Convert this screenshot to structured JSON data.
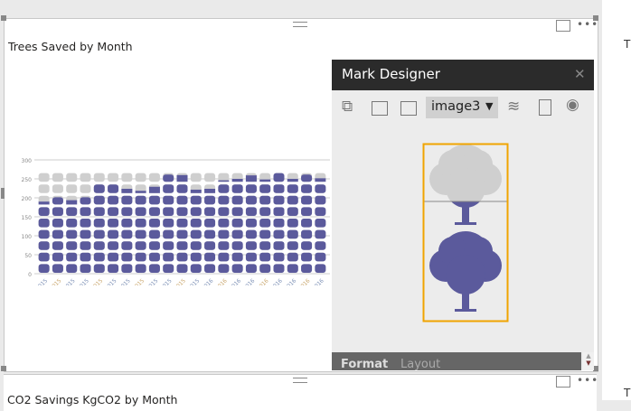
{
  "visual": {
    "title": "Trees Saved by Month",
    "focus_icon": "focus-mode-icon",
    "more": "•••"
  },
  "visual2": {
    "title": "CO2 Savings KgCO2 by Month"
  },
  "right_panel": {
    "letter1": "T",
    "letter2": "T"
  },
  "mark_designer": {
    "title": "Mark Designer",
    "close": "✕",
    "dropdown_value": "image3",
    "tabs": [
      "Format",
      "Layout"
    ]
  },
  "colors": {
    "fill": "#5b5a9c",
    "empty": "#cfcfcf",
    "selection": "#f0a400"
  },
  "chart_data": {
    "type": "pictograph",
    "title": "Trees Saved by Month",
    "ylim": [
      0,
      300
    ],
    "yticks": [
      0,
      50,
      100,
      150,
      200,
      250,
      300
    ],
    "units_per_icon": 30,
    "categories": [
      "Jan-2015",
      "Feb-2015",
      "Mar-2015",
      "Apr-2015",
      "May-2015",
      "Jun-2015",
      "Jul-2015",
      "Aug-2015",
      "Sep-2015",
      "Oct-2015",
      "Nov-2015",
      "Dec-2015",
      "Jan-2016",
      "Feb-2016",
      "Mar-2016",
      "Apr-2016",
      "May-2016",
      "Jun-2016",
      "Jul-2016",
      "Aug-2016",
      "Sep-2016"
    ],
    "values": [
      190,
      205,
      195,
      205,
      240,
      240,
      225,
      218,
      232,
      265,
      263,
      222,
      225,
      245,
      250,
      262,
      248,
      280,
      250,
      265,
      252
    ],
    "max_icons": 9
  }
}
